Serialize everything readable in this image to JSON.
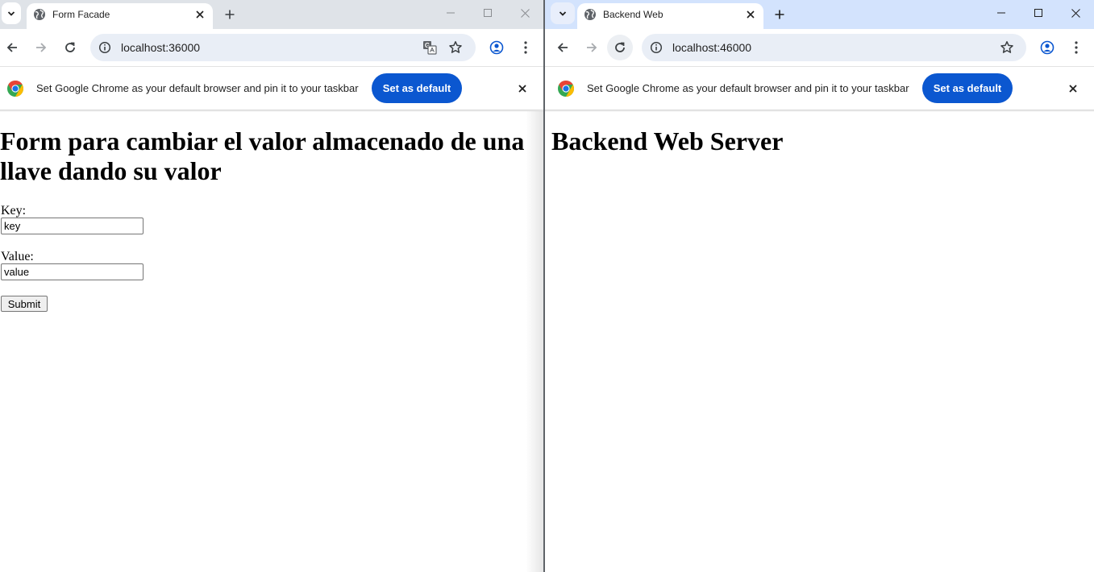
{
  "left_window": {
    "tab": {
      "title": "Form Facade"
    },
    "address_bar": {
      "url": "localhost:36000"
    },
    "infobar": {
      "message": "Set Google Chrome as your default browser and pin it to your taskbar",
      "button_label": "Set as default"
    },
    "page": {
      "heading": "Form para cambiar el valor almacenado de una llave dando su valor",
      "form": {
        "key_label": "Key:",
        "key_value": "key",
        "value_label": "Value:",
        "value_value": "value",
        "submit_label": "Submit"
      }
    }
  },
  "right_window": {
    "tab": {
      "title": "Backend Web"
    },
    "address_bar": {
      "url": "localhost:46000"
    },
    "infobar": {
      "message": "Set Google Chrome as your default browser and pin it to your taskbar",
      "button_label": "Set as default"
    },
    "page": {
      "heading": "Backend Web Server"
    }
  },
  "colors": {
    "accent": "#0b57d0",
    "left_tabstrip": "#dfe3e8",
    "right_tabstrip": "#d3e3fd",
    "omnibox": "#e9eef6"
  }
}
